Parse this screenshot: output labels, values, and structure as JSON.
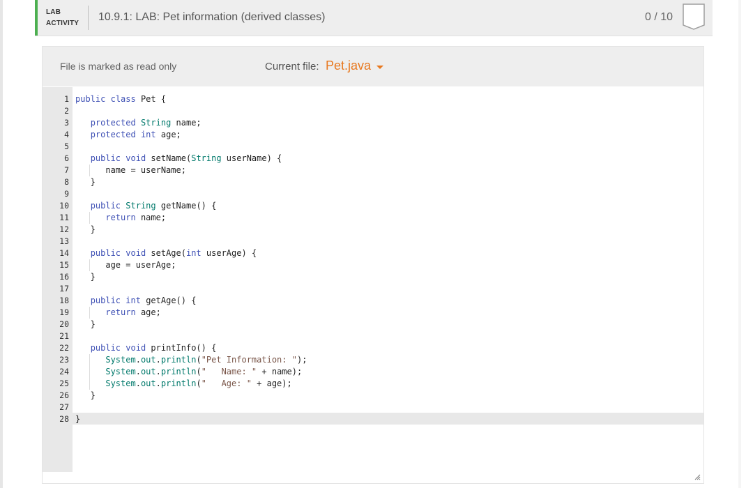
{
  "header": {
    "label_line1": "LAB",
    "label_line2": "ACTIVITY",
    "title": "10.9.1: LAB: Pet information (derived classes)",
    "score": "0 / 10",
    "accent_color": "#4caf50",
    "badge_icon": "completion-badge-icon"
  },
  "file_bar": {
    "readonly_note": "File is marked as read only",
    "current_file_label": "Current file:",
    "current_file_name": "Pet.java",
    "file_color": "#e8781e",
    "dropdown_icon": "caret-down-icon"
  },
  "editor": {
    "language": "java",
    "active_line": 28,
    "lines": [
      "public class Pet {",
      "",
      "   protected String name;",
      "   protected int age;",
      "",
      "   public void setName(String userName) {",
      "      name = userName;",
      "   }",
      "",
      "   public String getName() {",
      "      return name;",
      "   }",
      "",
      "   public void setAge(int userAge) {",
      "      age = userAge;",
      "   }",
      "",
      "   public int getAge() {",
      "      return age;",
      "   }",
      "",
      "   public void printInfo() {",
      "      System.out.println(\"Pet Information: \");",
      "      System.out.println(\"   Name: \" + name);",
      "      System.out.println(\"   Age: \" + age);",
      "   }",
      "",
      "}"
    ],
    "colors": {
      "keyword": "#3f51b5",
      "type": "#00796b",
      "string": "#795548",
      "plain": "#222222"
    }
  }
}
